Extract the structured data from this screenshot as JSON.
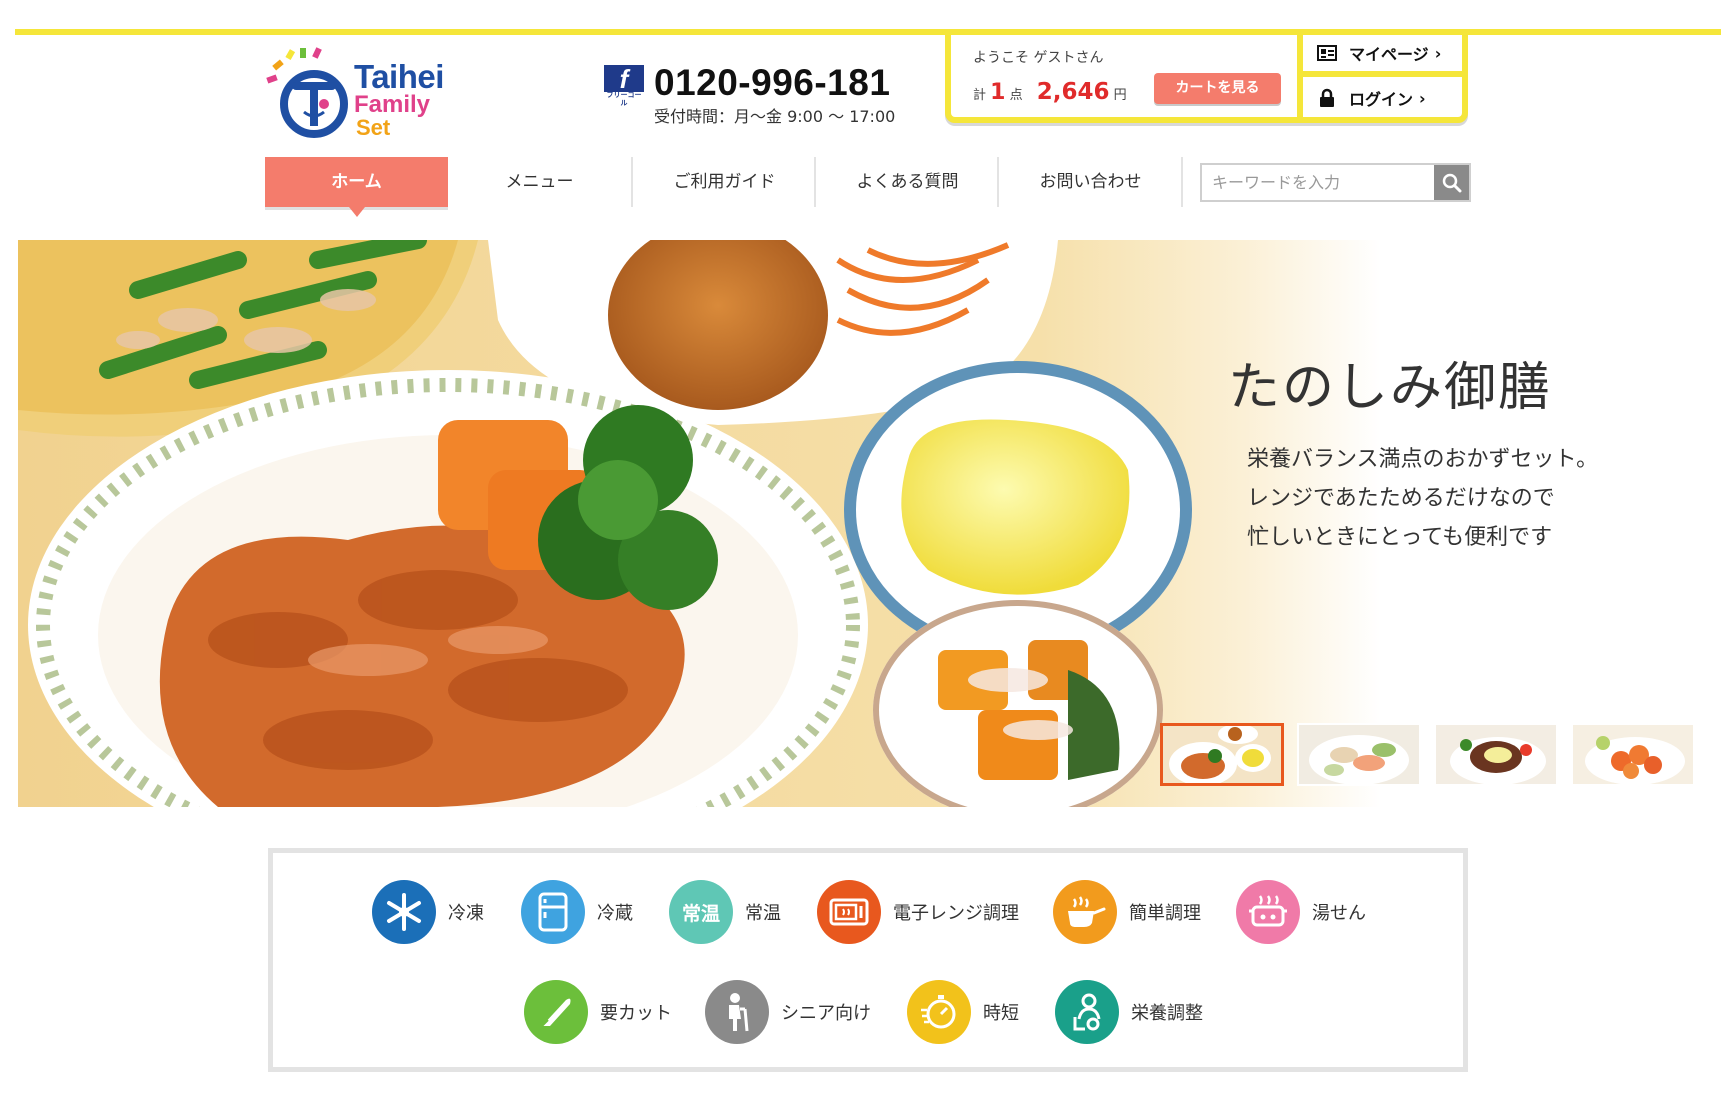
{
  "header": {
    "logo": {
      "line1": "Taihei",
      "line2": "Family",
      "line3": "Set"
    },
    "phone": {
      "badge": "f",
      "badge_caption": "フリーコール",
      "number": "0120-996-181",
      "hours": "受付時間：月～金 9:00 ～ 17:00"
    },
    "account": {
      "welcome": "ようこそ ゲストさん",
      "total_label": "計",
      "item_count": "1",
      "count_unit": "点",
      "price": "2,646",
      "price_unit": "円",
      "cart_button": "カートを見る",
      "mypage_label": "マイページ",
      "login_label": "ログイン"
    }
  },
  "nav": {
    "items": [
      {
        "label": "ホーム",
        "active": true
      },
      {
        "label": "メニュー"
      },
      {
        "label": "ご利用ガイド"
      },
      {
        "label": "よくある質問"
      },
      {
        "label": "お問い合わせ"
      }
    ],
    "search_placeholder": "キーワードを入力"
  },
  "hero": {
    "title": "たのしみ御膳",
    "desc": [
      "栄養バランス満点のおかずセット。",
      "レンジであたためるだけなので",
      "忙しいときにとっても便利です"
    ],
    "active_thumb": 1,
    "thumb_count": 4
  },
  "features": {
    "row1": [
      {
        "label": "冷凍",
        "icon": "snowflake-icon",
        "color": "#1b6fb8"
      },
      {
        "label": "冷蔵",
        "icon": "refrigerator-icon",
        "color": "#3fa3e0"
      },
      {
        "label": "常温",
        "icon": "room-temp-icon",
        "color": "#5fc7b5",
        "icon_text": "常温"
      },
      {
        "label": "電子レンジ調理",
        "icon": "microwave-icon",
        "color": "#e8581e"
      },
      {
        "label": "簡単調理",
        "icon": "cooking-pan-icon",
        "color": "#f29b1d"
      },
      {
        "label": "湯せん",
        "icon": "hot-water-pot-icon",
        "color": "#f07aa8"
      }
    ],
    "row2": [
      {
        "label": "要カット",
        "icon": "knife-icon",
        "color": "#6cbf3b"
      },
      {
        "label": "シニア向け",
        "icon": "senior-icon",
        "color": "#8a8a8a"
      },
      {
        "label": "時短",
        "icon": "stopwatch-icon",
        "color": "#f2c21b"
      },
      {
        "label": "栄養調整",
        "icon": "nutrition-icon",
        "color": "#1aa08a"
      }
    ]
  },
  "colors": {
    "accent_yellow": "#f5e63a",
    "accent_salmon": "#f47c6c",
    "price_red": "#e02b2b",
    "thumb_active": "#e8581e"
  }
}
